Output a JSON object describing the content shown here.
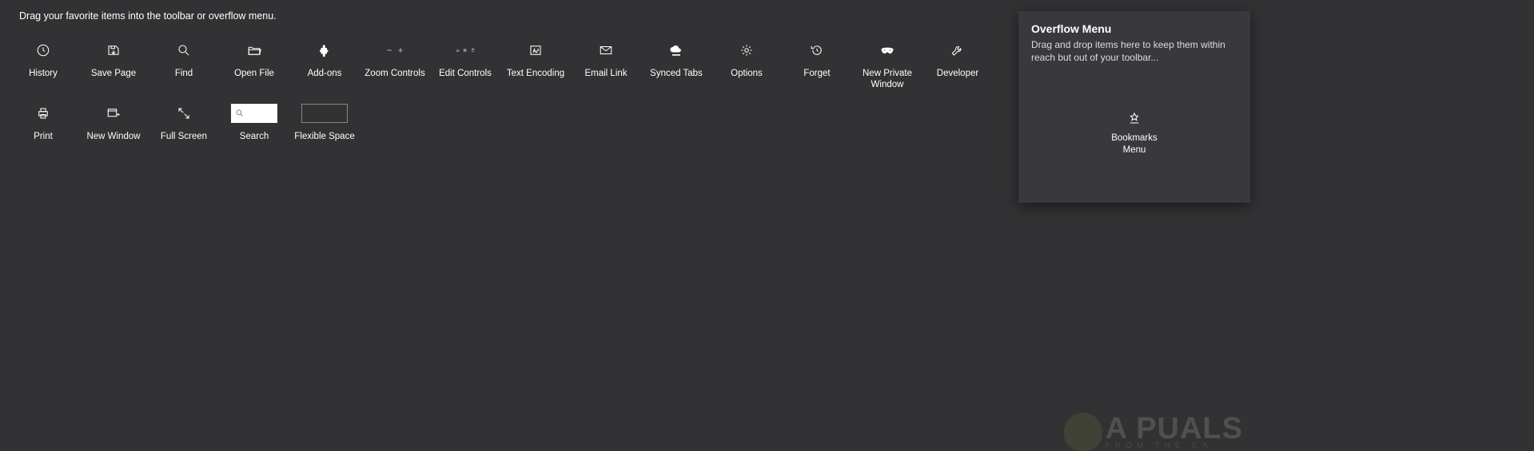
{
  "instruction": "Drag your favorite items into the toolbar or overflow menu.",
  "items": [
    {
      "id": "history",
      "label": "History",
      "icon": "clock"
    },
    {
      "id": "save-page",
      "label": "Save Page",
      "icon": "save"
    },
    {
      "id": "find",
      "label": "Find",
      "icon": "search"
    },
    {
      "id": "open-file",
      "label": "Open File",
      "icon": "folder-open"
    },
    {
      "id": "addons",
      "label": "Add-ons",
      "icon": "puzzle"
    },
    {
      "id": "zoom",
      "label": "Zoom Controls",
      "icon": "zoom-controls"
    },
    {
      "id": "edit",
      "label": "Edit Controls",
      "icon": "edit-controls"
    },
    {
      "id": "text-encoding",
      "label": "Text Encoding",
      "icon": "text-encoding"
    },
    {
      "id": "email-link",
      "label": "Email Link",
      "icon": "mail"
    },
    {
      "id": "synced-tabs",
      "label": "Synced Tabs",
      "icon": "cloud-tabs"
    },
    {
      "id": "options",
      "label": "Options",
      "icon": "gear"
    },
    {
      "id": "forget",
      "label": "Forget",
      "icon": "undo-clock"
    },
    {
      "id": "new-private",
      "label": "New Private\nWindow",
      "icon": "mask"
    },
    {
      "id": "developer",
      "label": "Developer",
      "icon": "wrench"
    },
    {
      "id": "print",
      "label": "Print",
      "icon": "printer"
    },
    {
      "id": "new-window",
      "label": "New Window",
      "icon": "window-plus"
    },
    {
      "id": "full-screen",
      "label": "Full Screen",
      "icon": "expand"
    },
    {
      "id": "search",
      "label": "Search",
      "icon": "search-box"
    },
    {
      "id": "flexible-space",
      "label": "Flexible Space",
      "icon": "flex-space"
    }
  ],
  "overflow": {
    "title": "Overflow Menu",
    "description": "Drag and drop items here to keep them within reach but out of your toolbar...",
    "items": [
      {
        "id": "bookmarks-menu",
        "label": "Bookmarks\nMenu",
        "icon": "bookmark-star"
      }
    ]
  },
  "watermark": {
    "big": "A  PUALS",
    "small": "FROM THE EX"
  }
}
